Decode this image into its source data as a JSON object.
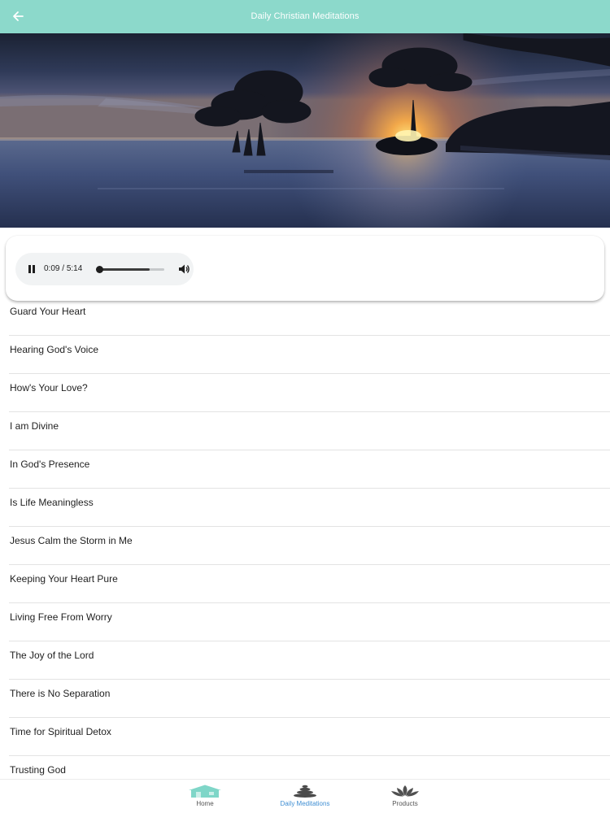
{
  "header": {
    "title": "Daily Christian Meditations",
    "back_icon": "arrow-left-icon"
  },
  "hero": {
    "image_icon": "sunset-lake-trees-image"
  },
  "player": {
    "current_time": "0:09",
    "separator": " / ",
    "duration": "5:14",
    "progress": 0.03,
    "volume": 0.78,
    "play_state_icon": "pause-icon",
    "volume_icon": "volume-icon"
  },
  "meditations": [
    "Guard Your Heart",
    "Hearing God's Voice",
    "How's Your Love?",
    "I am Divine",
    "In God's Presence",
    "Is Life Meaningless",
    "Jesus Calm the Storm in Me",
    "Keeping Your Heart Pure",
    "Living Free From Worry",
    "The Joy of the Lord",
    "There is No Separation",
    "Time for Spiritual Detox",
    "Trusting God"
  ],
  "bottom_nav": {
    "items": [
      {
        "label": "Home",
        "icon": "house-icon"
      },
      {
        "label": "Daily Meditations",
        "icon": "stacked-stones-icon"
      },
      {
        "label": "Products",
        "icon": "lotus-icon"
      }
    ],
    "active_index": 1
  },
  "colors": {
    "header_bg": "#8cd9cb",
    "active_nav": "#3f8ed3",
    "home_icon": "#7fd6c8"
  }
}
